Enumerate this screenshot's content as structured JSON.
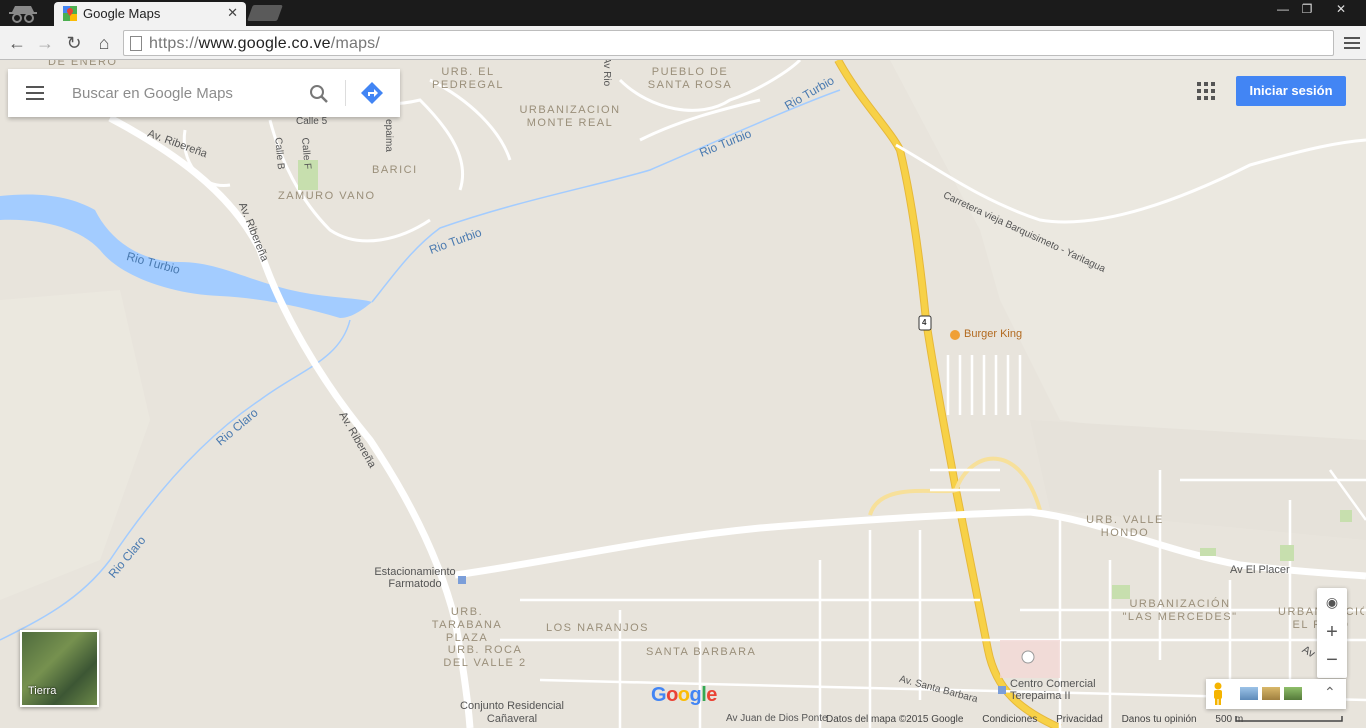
{
  "browser": {
    "tab_title": "Google Maps",
    "tab_close": "✕",
    "url_scheme": "https://",
    "url_host": "www.google.co.ve",
    "url_path": "/maps/",
    "window_buttons": [
      "—",
      "❐",
      "✕"
    ]
  },
  "search": {
    "placeholder": "Buscar en Google Maps"
  },
  "account": {
    "signin_label": "Iniciar sesión"
  },
  "layer_switcher": {
    "label": "Tierra"
  },
  "zoom": {
    "in": "+",
    "out": "−"
  },
  "footer": {
    "map_data": "Datos del mapa ©2015 Google",
    "terms": "Condiciones",
    "privacy": "Privacidad",
    "feedback": "Danos tu opinión",
    "scale": "500 m"
  },
  "logo": [
    "G",
    "o",
    "o",
    "g",
    "l",
    "e"
  ],
  "colors": {
    "highway": "#f7d147",
    "water": "#a3ccff",
    "land": "#e8e4dc",
    "road": "#ffffff",
    "button": "#4285f4"
  },
  "map_labels": {
    "de_enero": "DE ENERO",
    "urb_el_pedregal": "URB. EL PEDREGAL",
    "pueblo_santa_rosa": "PUEBLO DE SANTA ROSA",
    "urb_monte_real": "URBANIZACION MONTE REAL",
    "barici": "BARICI",
    "zamuro_vano": "ZAMURO VANO",
    "calle_5": "Calle 5",
    "calle_b": "Calle B",
    "calle_f": "Calle F",
    "epaima": "epaima",
    "av_rio": "Av Rio",
    "av_riberena_1": "Av. Ribereña",
    "av_riberena_2": "Av. Ribereña",
    "av_riberena_3": "Av. Ribereña",
    "rio_turbio_1": "Rio Turbio",
    "rio_turbio_2": "Rio Turbio",
    "rio_turbio_3": "Rio Turbio",
    "rio_turbio_4": "Rio Turbio",
    "rio_claro_1": "Rio Claro",
    "rio_claro_2": "Rio Claro",
    "carretera": "Carretera vieja Barquisimeto - Yaritagua",
    "route_4": "4",
    "burger_king": "Burger King",
    "estacionamiento": "Estacionamiento Farmatodo",
    "urb_tarabana": "URB. TARABANA PLAZA",
    "los_naranjos": "LOS NARANJOS",
    "urb_roca": "URB. ROCA DEL VALLE 2",
    "santa_barbara": "SANTA BARBARA",
    "urb_valle_hondo": "URB. VALLE HONDO",
    "av_el_placer": "Av El Placer",
    "urb_las_mercedes": "URBANIZACIÓN \"LAS MERCEDES\"",
    "urb_el_reto": "URBANIZACIÓN EL RETO",
    "centro_comercial": "Centro Comercial Terepaima II",
    "av_santa_barbara": "Av. Santa Barbara",
    "conjunto": "Conjunto Residencial Cañaveral",
    "av_juan": "Av Juan de Dios Ponte",
    "av_right": "Av"
  }
}
